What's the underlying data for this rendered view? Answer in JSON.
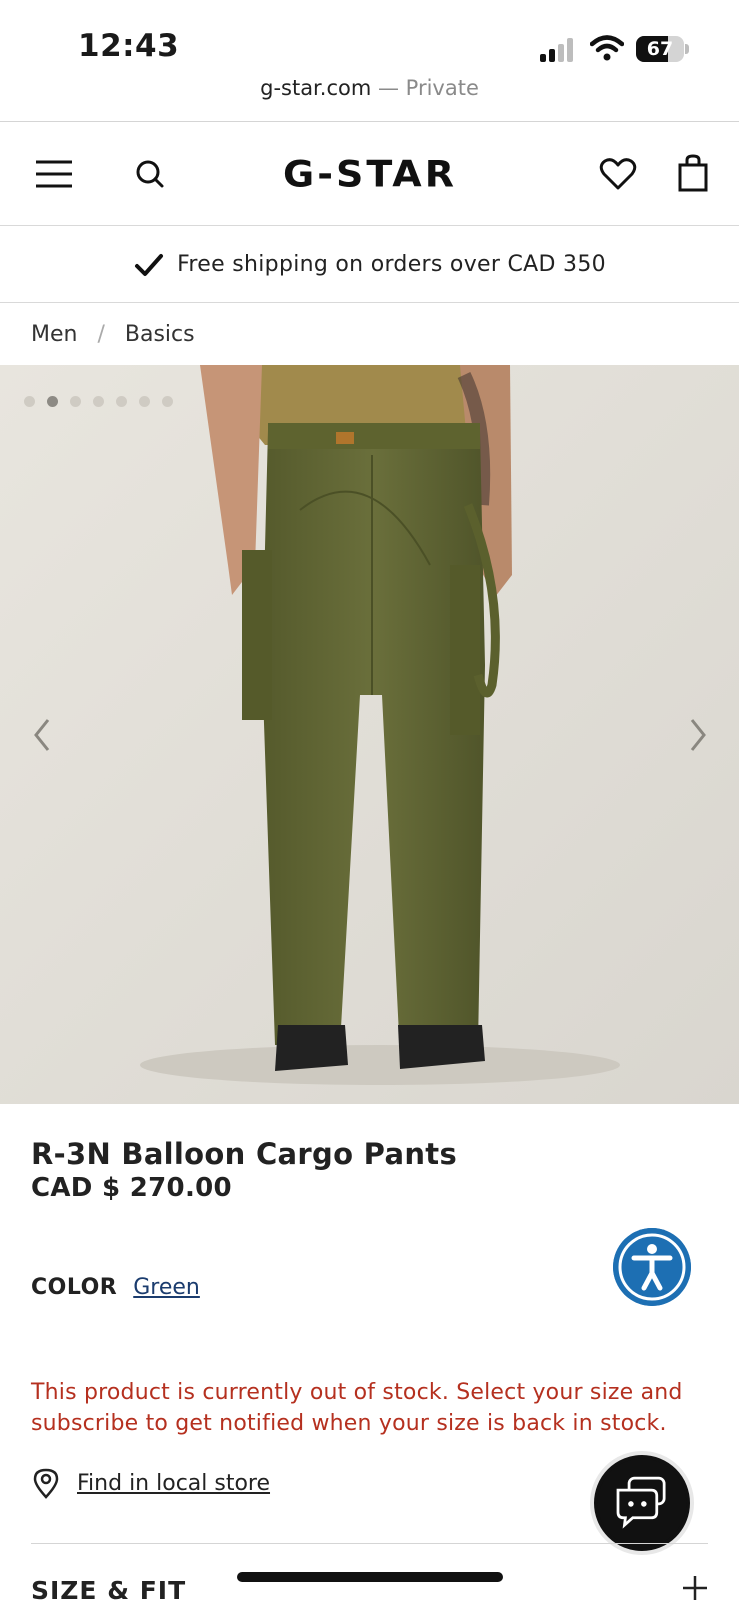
{
  "status_bar": {
    "time": "12:43",
    "battery": "67",
    "battery_level": 0.67
  },
  "browser": {
    "domain": "g-star.com",
    "separator": "—",
    "mode": "Private"
  },
  "header": {
    "logo": "G-STAR",
    "icons": [
      "menu-icon",
      "search-icon",
      "heart-icon",
      "shopping-bag-icon"
    ]
  },
  "promo": {
    "text": "Free shipping on orders over CAD 350"
  },
  "breadcrumb": {
    "items": [
      "Men",
      "Basics"
    ],
    "separator": "/"
  },
  "gallery": {
    "image_count": 7,
    "active_index": 1
  },
  "product": {
    "name": "R-3N Balloon Cargo Pants",
    "price": "CAD $ 270.00",
    "color_label": "COLOR",
    "color_value": "Green",
    "stock_message": "This product is currently out of stock. Select your size and subscribe to get notified when your size is back in stock.",
    "find_store": "Find in local store",
    "size_fit": "SIZE & FIT"
  },
  "colors": {
    "accessibility_blue": "#1d6fb3",
    "stock_red": "#b5301f",
    "link_blue": "#1b3c6e",
    "pants_olive": "#5f6434"
  }
}
